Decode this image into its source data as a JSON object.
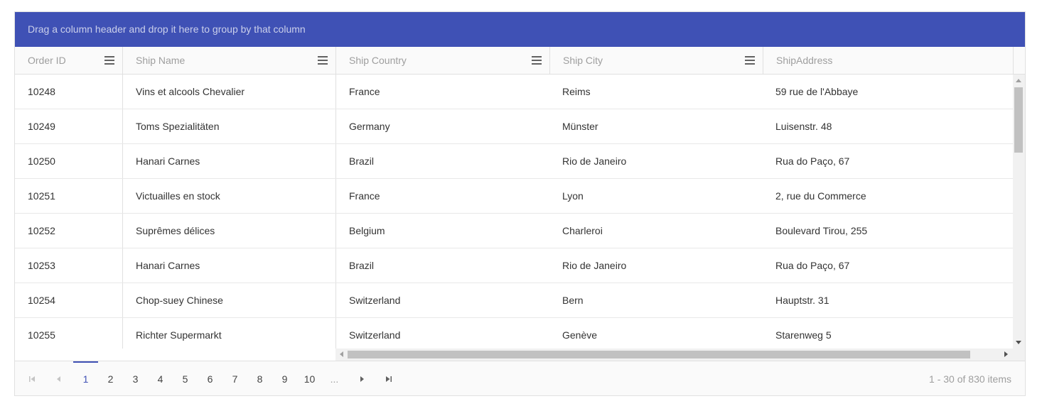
{
  "group_panel": {
    "text": "Drag a column header and drop it here to group by that column"
  },
  "colors": {
    "accent": "#3f51b5",
    "header_bg": "#fafafa",
    "border": "#e0e0e0"
  },
  "columns": [
    {
      "label": "Order ID",
      "menu_icon": "menu-icon"
    },
    {
      "label": "Ship Name",
      "menu_icon": "menu-icon"
    },
    {
      "label": "Ship Country",
      "menu_icon": "menu-icon"
    },
    {
      "label": "Ship City",
      "menu_icon": "menu-icon"
    },
    {
      "label": "ShipAddress"
    }
  ],
  "rows": [
    [
      "10248",
      "Vins et alcools Chevalier",
      "France",
      "Reims",
      "59 rue de l'Abbaye"
    ],
    [
      "10249",
      "Toms Spezialitäten",
      "Germany",
      "Münster",
      "Luisenstr. 48"
    ],
    [
      "10250",
      "Hanari Carnes",
      "Brazil",
      "Rio de Janeiro",
      "Rua do Paço, 67"
    ],
    [
      "10251",
      "Victuailles en stock",
      "France",
      "Lyon",
      "2, rue du Commerce"
    ],
    [
      "10252",
      "Suprêmes délices",
      "Belgium",
      "Charleroi",
      "Boulevard Tirou, 255"
    ],
    [
      "10253",
      "Hanari Carnes",
      "Brazil",
      "Rio de Janeiro",
      "Rua do Paço, 67"
    ],
    [
      "10254",
      "Chop-suey Chinese",
      "Switzerland",
      "Bern",
      "Hauptstr. 31"
    ],
    [
      "10255",
      "Richter Supermarkt",
      "Switzerland",
      "Genève",
      "Starenweg 5"
    ]
  ],
  "pager": {
    "pages": [
      "1",
      "2",
      "3",
      "4",
      "5",
      "6",
      "7",
      "8",
      "9",
      "10",
      "..."
    ],
    "current_page": "1",
    "info": "1 - 30 of 830 items"
  }
}
